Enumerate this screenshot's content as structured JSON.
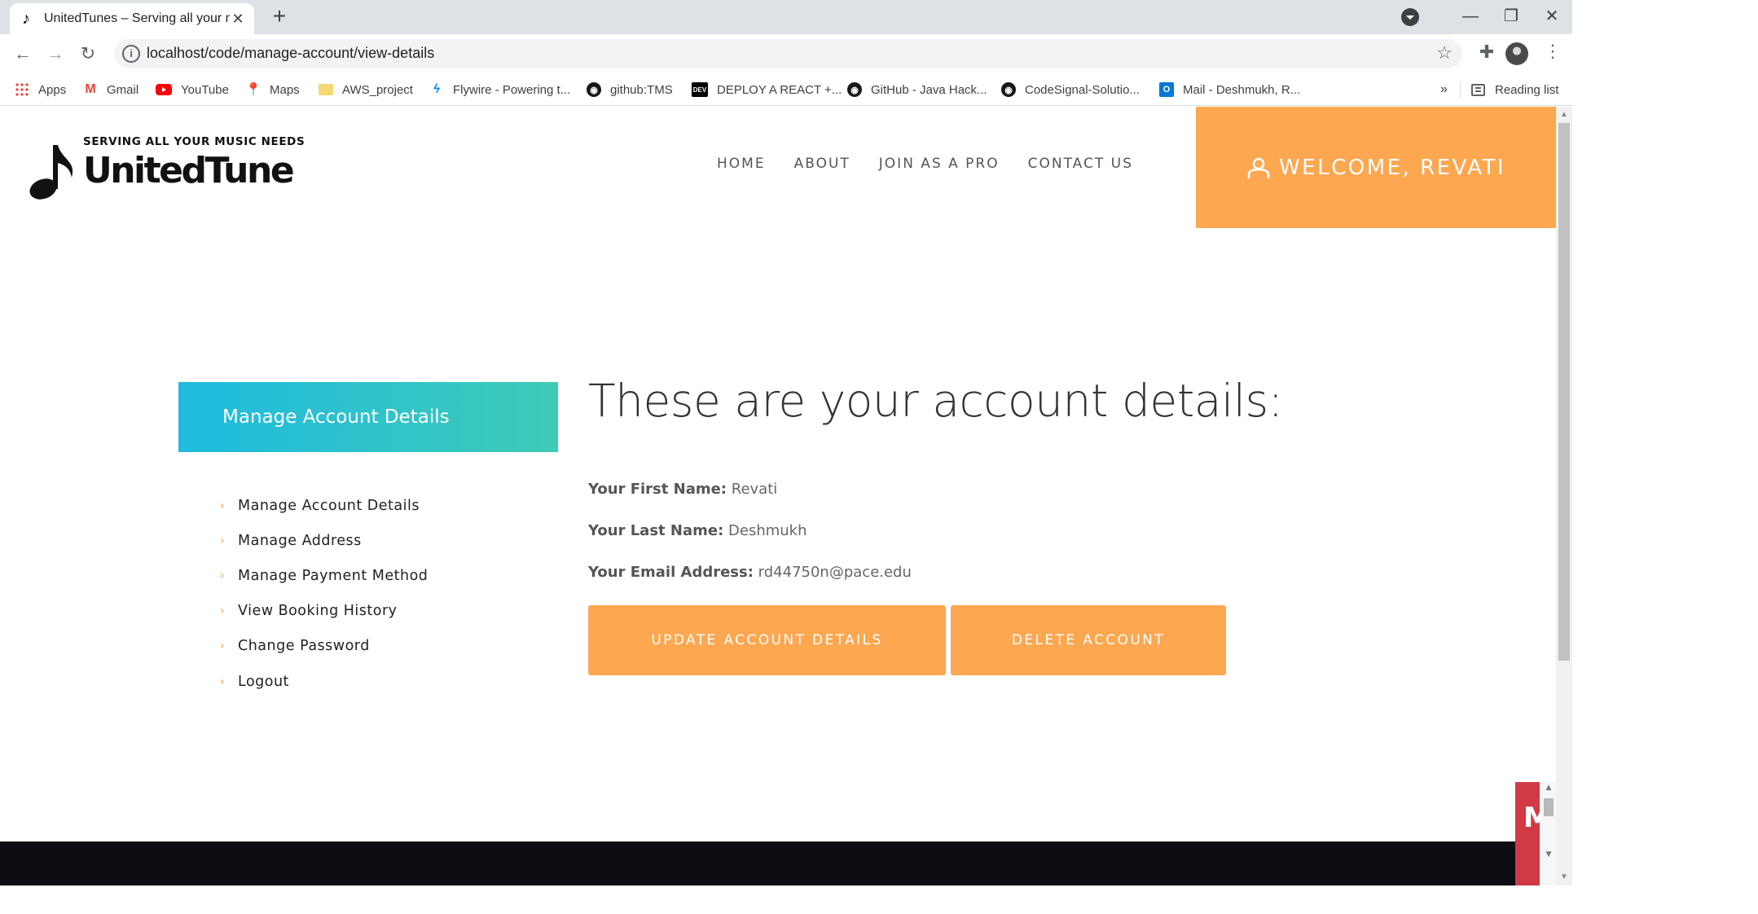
{
  "browser": {
    "tab_title": "UnitedTunes – Serving all your m",
    "tab_close": "✕",
    "new_tab": "+",
    "url": "localhost/code/manage-account/view-details",
    "window_controls": {
      "minimize": "—",
      "restore": "❐",
      "close": "✕"
    },
    "bookmarks": [
      {
        "label": "Apps",
        "icon": "apps-grid-icon"
      },
      {
        "label": "Gmail",
        "icon": "gmail-icon"
      },
      {
        "label": "YouTube",
        "icon": "youtube-icon"
      },
      {
        "label": "Maps",
        "icon": "maps-pin-icon"
      },
      {
        "label": "AWS_project",
        "icon": "folder-icon"
      },
      {
        "label": "Flywire - Powering t...",
        "icon": "flywire-icon"
      },
      {
        "label": "github:TMS",
        "icon": "github-icon"
      },
      {
        "label": "DEPLOY A REACT +...",
        "icon": "dev-icon"
      },
      {
        "label": "GitHub - Java Hack...",
        "icon": "github-icon"
      },
      {
        "label": "CodeSignal-Solutio...",
        "icon": "github-icon"
      },
      {
        "label": "Mail - Deshmukh, R...",
        "icon": "outlook-icon"
      }
    ],
    "bookmarks_more": "»",
    "reading_list": "Reading list"
  },
  "site": {
    "logo_tagline": "SERVING ALL YOUR MUSIC NEEDS",
    "logo_name": "UnitedTune",
    "nav": [
      "HOME",
      "ABOUT",
      "JOIN AS A PRO",
      "CONTACT US"
    ],
    "welcome": "WELCOME, REVATI"
  },
  "sidebar": {
    "heading": "Manage Account Details",
    "items": [
      "Manage Account Details",
      "Manage Address",
      "Manage Payment Method",
      "View Booking History",
      "Change Password",
      "Logout"
    ]
  },
  "account": {
    "title": "These are your account details:",
    "first_name_label": "Your First Name:",
    "first_name": "Revati",
    "last_name_label": "Your Last Name:",
    "last_name": "Deshmukh",
    "email_label": "Your Email Address:",
    "email": "rd44750n@pace.edu",
    "update_button": "UPDATE ACCOUNT DETAILS",
    "delete_button": "DELETE ACCOUNT"
  },
  "widget": {
    "letter": "M"
  },
  "colors": {
    "accent_orange": "#fda750",
    "sidebar_gradient_start": "#1ebbdf",
    "sidebar_gradient_end": "#3fcab7",
    "footer": "#0c0c12"
  }
}
